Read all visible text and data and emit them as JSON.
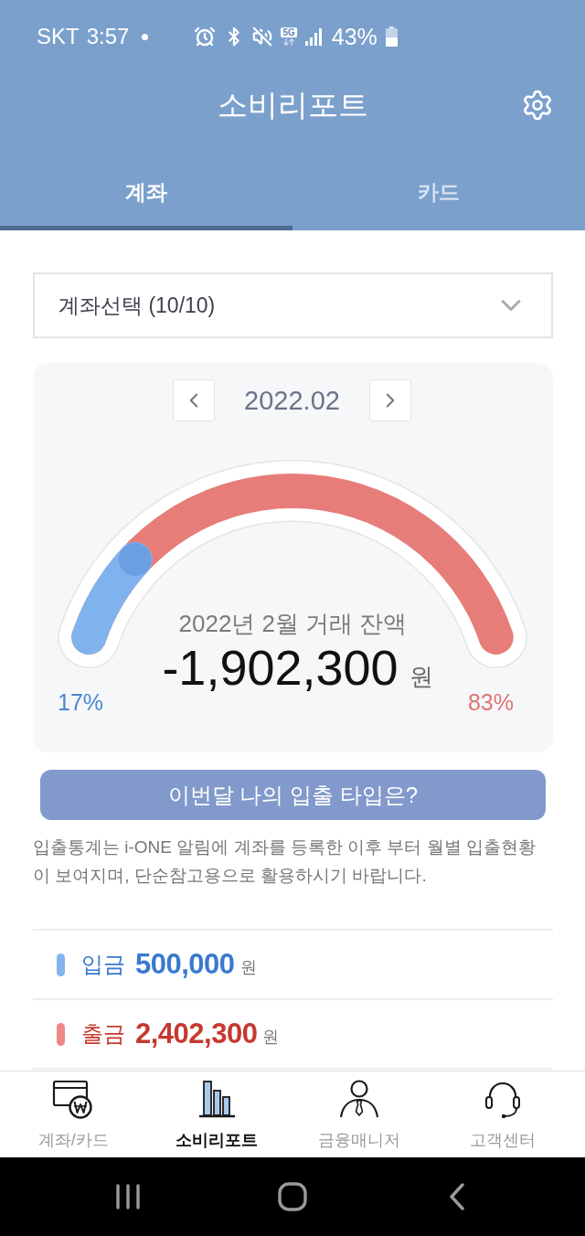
{
  "status_bar": {
    "carrier": "SKT",
    "time": "3:57",
    "network": "5G",
    "battery": "43%"
  },
  "header": {
    "title": "소비리포트"
  },
  "tabs": [
    {
      "label": "계좌",
      "selected": true
    },
    {
      "label": "카드",
      "selected": false
    }
  ],
  "account_select": {
    "value": "계좌선택 (10/10)"
  },
  "report_card": {
    "month": "2022.02",
    "gauge": {
      "caption": "2022년 2월 거래 잔액",
      "amount": "-1,902,300",
      "unit": "원",
      "level": 0.17,
      "left_percent": "17%",
      "right_percent": "83%"
    }
  },
  "type_button": {
    "label": "이번달 나의 입출 타입은?"
  },
  "notice": "입출통계는 i-ONE 알림에 계좌를 등록한 이후 부터 월별 입출현황이 보여지며, 단순참고용으로 활용하시기 바랍니다.",
  "summary_rows": [
    {
      "kind": "deposit",
      "color": "#85b4ec",
      "label": "입금",
      "amount": "500,000",
      "unit": "원"
    },
    {
      "kind": "withdrawal",
      "color": "#ee8884",
      "label": "출금",
      "amount": "2,402,300",
      "unit": "원"
    }
  ],
  "bottom_nav": [
    {
      "label": "계좌/카드",
      "selected": false
    },
    {
      "label": "소비리포트",
      "selected": true
    },
    {
      "label": "금융매니저",
      "selected": false
    },
    {
      "label": "고객센터",
      "selected": false
    }
  ]
}
